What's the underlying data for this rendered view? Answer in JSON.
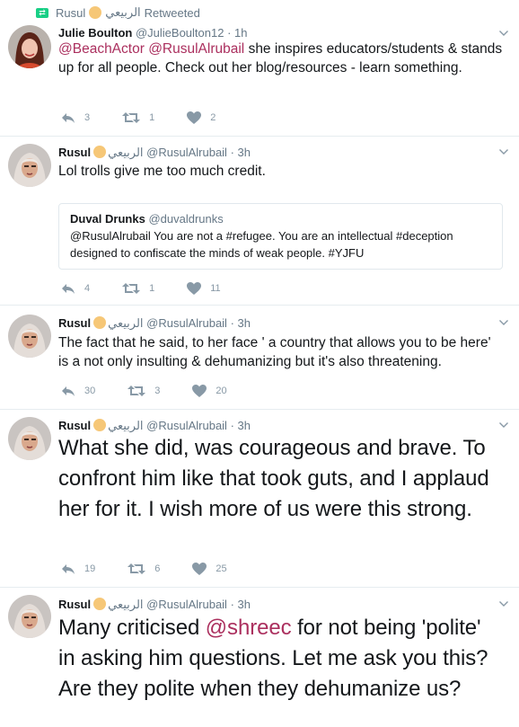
{
  "retweet_context": {
    "user": "Rusul",
    "arabic": "الربيعي",
    "label": "Retweeted"
  },
  "tweets": [
    {
      "name": "Julie Boulton",
      "arabic": "",
      "handle": "@JulieBoulton12",
      "time": "1h",
      "mentions": [
        "@BeachActor",
        "@RusulAlrubail"
      ],
      "text": "she inspires educators/students & stands up for all people. Check out her blog/resources - learn something.",
      "replies": "3",
      "retweets": "1",
      "likes": "2"
    },
    {
      "name": "Rusul",
      "arabic": "الربيعي",
      "handle": "@RusulAlrubail",
      "time": "3h",
      "text": "Lol trolls give me too much credit.",
      "quote": {
        "name": "Duval Drunks",
        "handle": "@duvaldrunks",
        "text": "@RusulAlrubail You are not a #refugee. You are an intellectual #deception designed to confiscate the minds of weak people. #YJFU"
      },
      "replies": "4",
      "retweets": "1",
      "likes": "11"
    },
    {
      "name": "Rusul",
      "arabic": "الربيعي",
      "handle": "@RusulAlrubail",
      "time": "3h",
      "text": "The fact that he said, to her face ' a country that allows you to be here' is a not only insulting & dehumanizing but it's also threatening.",
      "replies": "30",
      "retweets": "3",
      "likes": "20"
    },
    {
      "name": "Rusul",
      "arabic": "الربيعي",
      "handle": "@RusulAlrubail",
      "time": "3h",
      "text": "What she did, was courageous and brave. To confront him like that took guts, and I applaud her for it. I wish more of us were this strong.",
      "replies": "19",
      "retweets": "6",
      "likes": "25"
    },
    {
      "name": "Rusul",
      "arabic": "الربيعي",
      "handle": "@RusulAlrubail",
      "time": "3h",
      "text_before": "Many criticised",
      "mention": "@shreec",
      "text_after": "for not being 'polite' in asking him questions. Let me ask you this? Are they polite when they dehumanize us?"
    }
  ],
  "colors": {
    "mention": "#ab2f5e",
    "retweet_green": "#19cf86",
    "muted": "#657786",
    "icon": "#8899a6"
  }
}
